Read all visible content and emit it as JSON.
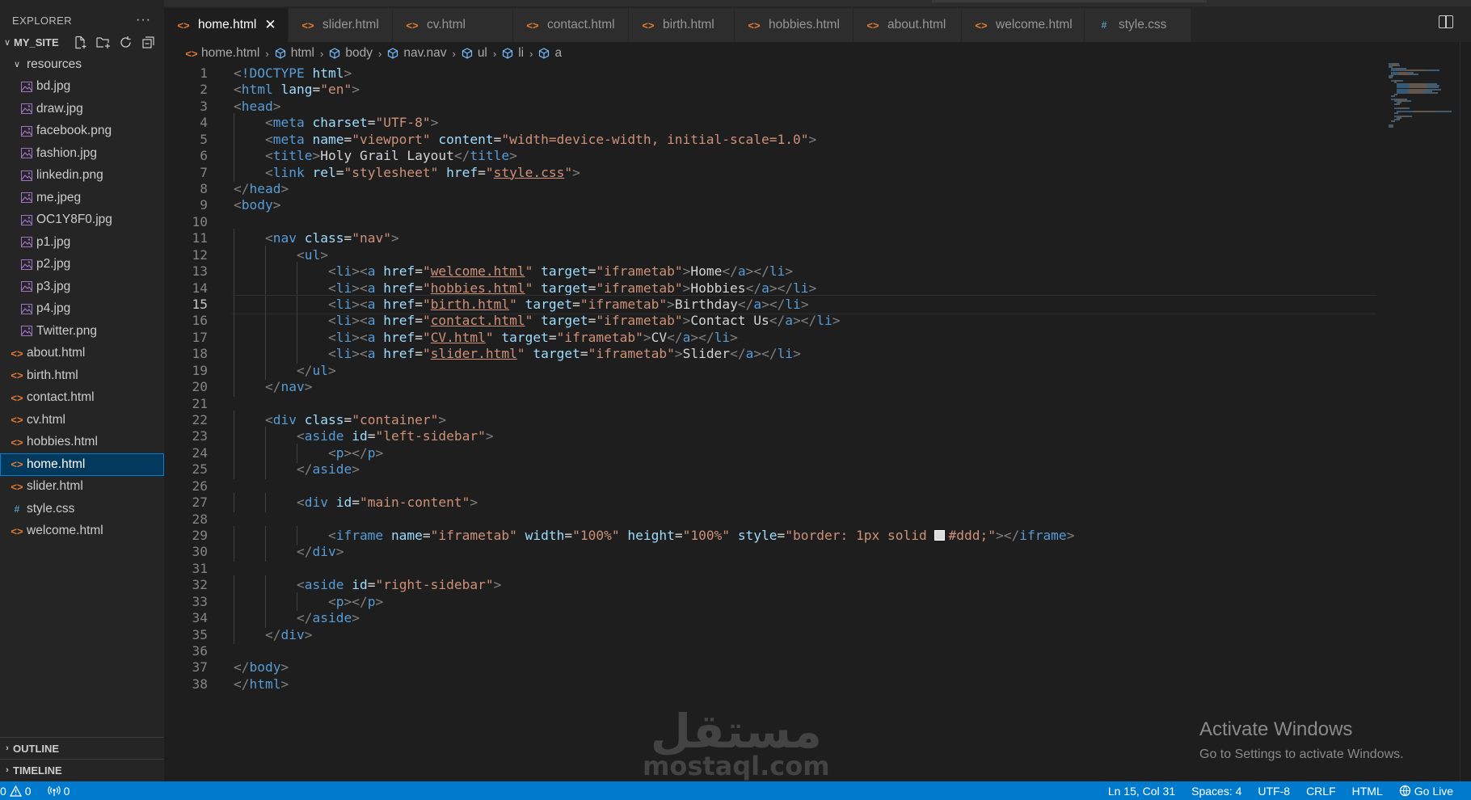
{
  "explorer": {
    "title": "EXPLORER",
    "more": "···",
    "root": "MY_SITE",
    "folder": "resources",
    "resources": [
      "bd.jpg",
      "draw.jpg",
      "facebook.png",
      "fashion.jpg",
      "linkedin.png",
      "me.jpeg",
      "OC1Y8F0.jpg",
      "p1.jpg",
      "p2.jpg",
      "p3.jpg",
      "p4.jpg",
      "Twitter.png"
    ],
    "files": [
      {
        "name": "about.html",
        "type": "html"
      },
      {
        "name": "birth.html",
        "type": "html"
      },
      {
        "name": "contact.html",
        "type": "html"
      },
      {
        "name": "cv.html",
        "type": "html"
      },
      {
        "name": "hobbies.html",
        "type": "html"
      },
      {
        "name": "home.html",
        "type": "html"
      },
      {
        "name": "slider.html",
        "type": "html"
      },
      {
        "name": "style.css",
        "type": "css"
      },
      {
        "name": "welcome.html",
        "type": "html"
      }
    ],
    "selected": "home.html",
    "outline": "OUTLINE",
    "timeline": "TIMELINE"
  },
  "tabs": [
    {
      "label": "home.html",
      "type": "html",
      "active": true
    },
    {
      "label": "slider.html",
      "type": "html"
    },
    {
      "label": "cv.html",
      "type": "html"
    },
    {
      "label": "contact.html",
      "type": "html"
    },
    {
      "label": "birth.html",
      "type": "html"
    },
    {
      "label": "hobbies.html",
      "type": "html"
    },
    {
      "label": "about.html",
      "type": "html"
    },
    {
      "label": "welcome.html",
      "type": "html"
    },
    {
      "label": "style.css",
      "type": "css"
    }
  ],
  "breadcrumb": [
    "home.html",
    "html",
    "body",
    "nav.nav",
    "ul",
    "li",
    "a"
  ],
  "code": {
    "current_line": 15,
    "lines": [
      "<!DOCTYPE html>",
      "<html lang=\"en\">",
      "<head>",
      "    <meta charset=\"UTF-8\">",
      "    <meta name=\"viewport\" content=\"width=device-width, initial-scale=1.0\">",
      "    <title>Holy Grail Layout</title>",
      "    <link rel=\"stylesheet\" href=\"style.css\">",
      "</head>",
      "<body>",
      "",
      "    <nav class=\"nav\">",
      "        <ul>",
      "            <li><a href=\"welcome.html\" target=\"iframetab\">Home</a></li>",
      "            <li><a href=\"hobbies.html\" target=\"iframetab\">Hobbies</a></li>",
      "            <li><a href=\"birth.html\" target=\"iframetab\">Birthday</a></li>",
      "            <li><a href=\"contact.html\" target=\"iframetab\">Contact Us</a></li>",
      "            <li><a href=\"CV.html\" target=\"iframetab\">CV</a></li>",
      "            <li><a href=\"slider.html\" target=\"iframetab\">Slider</a></li>",
      "        </ul>",
      "    </nav>",
      "",
      "    <div class=\"container\">",
      "        <aside id=\"left-sidebar\">",
      "            <p></p>",
      "        </aside>",
      "",
      "        <div id=\"main-content\">",
      "",
      "            <iframe name=\"iframetab\" width=\"100%\" height=\"100%\" style=\"border: 1px solid #ddd;\"></iframe>",
      "        </div>",
      "",
      "        <aside id=\"right-sidebar\">",
      "            <p></p>",
      "        </aside>",
      "    </div>",
      "",
      "</body>",
      "</html>"
    ]
  },
  "watermark": {
    "arabic": "مستقل",
    "latin": "mostaql.com"
  },
  "activate": {
    "title": "Activate Windows",
    "subtitle": "Go to Settings to activate Windows."
  },
  "status": {
    "errors": "0",
    "warnings": "0",
    "ports": "0",
    "position": "Ln 15, Col 31",
    "spaces": "Spaces: 4",
    "encoding": "UTF-8",
    "eol": "CRLF",
    "language": "HTML",
    "golive": "Go Live"
  },
  "colors": {
    "tag": "#569cd6",
    "attr": "#9cdcfe",
    "string": "#ce9178",
    "punct": "#808080",
    "statusbar": "#007acc",
    "html_icon": "#e37933",
    "css_icon": "#519aba"
  }
}
